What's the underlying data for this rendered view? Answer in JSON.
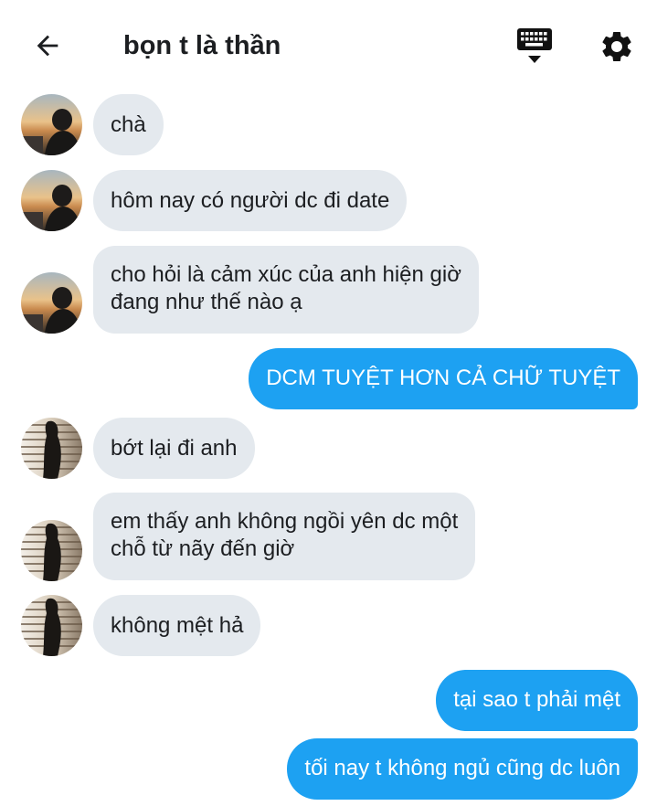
{
  "header": {
    "title": "bọn t là thần",
    "back_icon": "arrow-left-icon",
    "keyboard_icon": "keyboard-icon",
    "settings_icon": "gear-icon"
  },
  "colors": {
    "incoming_bubble": "#e4e9ee",
    "outgoing_bubble": "#1da1f2",
    "text": "#1c1e21"
  },
  "messages": [
    {
      "direction": "incoming",
      "sender_avatar": "avatar-1",
      "lines": [
        "chà"
      ]
    },
    {
      "direction": "incoming",
      "sender_avatar": "avatar-1",
      "lines": [
        "hôm nay có người dc đi date"
      ]
    },
    {
      "direction": "incoming",
      "sender_avatar": "avatar-1",
      "lines": [
        "cho hỏi là cảm xúc của anh hiện giờ",
        "đang như thế nào ạ"
      ]
    },
    {
      "direction": "outgoing",
      "lines": [
        "DCM TUYỆT HƠN CẢ CHỮ TUYỆT"
      ]
    },
    {
      "direction": "incoming",
      "sender_avatar": "avatar-2",
      "lines": [
        "bớt lại đi anh"
      ]
    },
    {
      "direction": "incoming",
      "sender_avatar": "avatar-2",
      "lines": [
        "em thấy anh không ngồi yên dc một",
        "chỗ từ nãy đến giờ"
      ]
    },
    {
      "direction": "incoming",
      "sender_avatar": "avatar-2",
      "lines": [
        "không mệt hả"
      ]
    },
    {
      "direction": "outgoing",
      "lines": [
        "tại sao t phải mệt"
      ]
    },
    {
      "direction": "outgoing",
      "lines": [
        "tối nay t không ngủ cũng dc luôn"
      ]
    }
  ]
}
